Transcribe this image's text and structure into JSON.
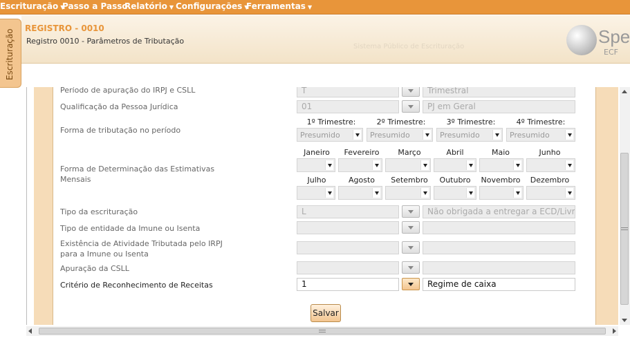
{
  "menu": {
    "items": [
      {
        "label": "Escrituração",
        "caret": "▼"
      },
      {
        "label": "Passo a Passo",
        "caret": ""
      },
      {
        "label": "Relatório",
        "caret": "▼"
      },
      {
        "label": "Configurações",
        "caret": "▼"
      },
      {
        "label": "Ferramentas",
        "caret": "▼"
      }
    ]
  },
  "side_tab": {
    "label": "Escrituração"
  },
  "header": {
    "title": "REGISTRO - 0010",
    "subtitle": "Registro 0010 - Parâmetros de Tributação",
    "watermark": "Sistema Público de Escrituração",
    "logo_main": "Spe",
    "logo_sub": "ECF"
  },
  "form": {
    "periodo": {
      "label": "Período de apuração do IRPJ e CSLL",
      "code": "T",
      "desc": "Trimestral"
    },
    "qualificacao": {
      "label": "Qualificação da Pessoa Jurídica",
      "code": "01",
      "desc": "PJ em Geral"
    },
    "forma_tributacao": {
      "label": "Forma de tributação no período",
      "quarters": [
        {
          "head": "1º Trimestre:",
          "value": "Presumido"
        },
        {
          "head": "2º Trimestre:",
          "value": "Presumido"
        },
        {
          "head": "3º Trimestre:",
          "value": "Presumido"
        },
        {
          "head": "4º Trimestre:",
          "value": "Presumido"
        }
      ]
    },
    "estimativas": {
      "label_line1": "Forma de Determinação das Estimativas",
      "label_line2": "Mensais",
      "months_row1": [
        "Janeiro",
        "Fevereiro",
        "Março",
        "Abril",
        "Maio",
        "Junho"
      ],
      "months_row2": [
        "Julho",
        "Agosto",
        "Setembro",
        "Outubro",
        "Novembro",
        "Dezembro"
      ]
    },
    "tipo_escrituracao": {
      "label": "Tipo da escrituração",
      "code": "L",
      "desc": "Não obrigada a entregar a ECD/Livro C"
    },
    "tipo_entidade": {
      "label": "Tipo de entidade da Imune ou Isenta",
      "code": "",
      "desc": ""
    },
    "atividade_tributada": {
      "label_line1": "Existência de Atividade Tributada pelo IRPJ",
      "label_line2": "para a Imune ou Isenta",
      "code": "",
      "desc": ""
    },
    "apuracao_csll": {
      "label": "Apuração da CSLL",
      "code": "",
      "desc": ""
    },
    "criterio_receitas": {
      "label": "Critério de Reconhecimento de Receitas",
      "code": "1",
      "desc": "Regime de caixa"
    },
    "save_label": "Salvar"
  },
  "colors": {
    "accent": "#e8953a",
    "rail": "#f6dcb8",
    "title": "#e8953a"
  }
}
